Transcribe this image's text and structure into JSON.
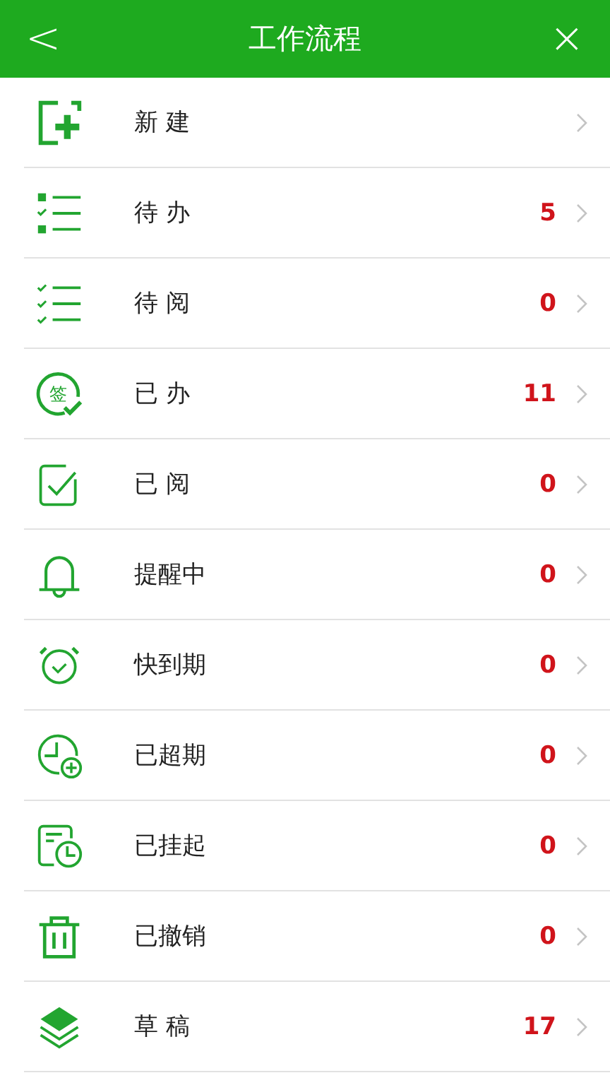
{
  "header": {
    "title": "工作流程",
    "back": "<",
    "close": "×"
  },
  "items": [
    {
      "kind": "new",
      "label": "新 建"
    },
    {
      "kind": "todo",
      "label": "待 办",
      "count": "5"
    },
    {
      "kind": "toread",
      "label": "待 阅",
      "count": "0"
    },
    {
      "kind": "signed",
      "label": "已 办",
      "count": "11",
      "icon_text": "签"
    },
    {
      "kind": "read",
      "label": "已 阅",
      "count": "0"
    },
    {
      "kind": "bell",
      "label": "提醒中",
      "count": "0"
    },
    {
      "kind": "alarm",
      "label": "快到期",
      "count": "0"
    },
    {
      "kind": "overdue",
      "label": "已超期",
      "count": "0"
    },
    {
      "kind": "suspended",
      "label": "已挂起",
      "count": "0"
    },
    {
      "kind": "trash",
      "label": "已撤销",
      "count": "0"
    },
    {
      "kind": "layers",
      "label": "草 稿",
      "count": "17"
    }
  ]
}
